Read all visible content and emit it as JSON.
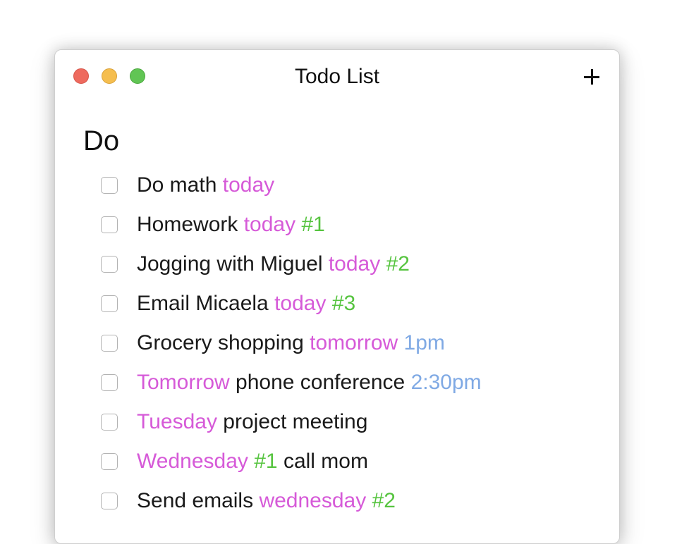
{
  "window": {
    "title": "Todo List",
    "add_label": "+"
  },
  "section": {
    "heading": "Do"
  },
  "colors": {
    "date": "#d65ad8",
    "tag": "#56c43f",
    "time": "#7fa9e4",
    "text": "#1a1a1a"
  },
  "todos": [
    {
      "checked": false,
      "segments": [
        {
          "text": "Do math",
          "kind": "plain"
        },
        {
          "text": "today",
          "kind": "date"
        }
      ]
    },
    {
      "checked": false,
      "segments": [
        {
          "text": "Homework",
          "kind": "plain"
        },
        {
          "text": "today",
          "kind": "date"
        },
        {
          "text": "#1",
          "kind": "tag"
        }
      ]
    },
    {
      "checked": false,
      "segments": [
        {
          "text": "Jogging with Miguel",
          "kind": "plain"
        },
        {
          "text": "today",
          "kind": "date"
        },
        {
          "text": "#2",
          "kind": "tag"
        }
      ]
    },
    {
      "checked": false,
      "segments": [
        {
          "text": "Email Micaela",
          "kind": "plain"
        },
        {
          "text": "today",
          "kind": "date"
        },
        {
          "text": "#3",
          "kind": "tag"
        }
      ]
    },
    {
      "checked": false,
      "segments": [
        {
          "text": "Grocery shopping",
          "kind": "plain"
        },
        {
          "text": "tomorrow",
          "kind": "date"
        },
        {
          "text": "1pm",
          "kind": "time"
        }
      ]
    },
    {
      "checked": false,
      "segments": [
        {
          "text": "Tomorrow",
          "kind": "date"
        },
        {
          "text": "phone conference",
          "kind": "plain"
        },
        {
          "text": "2:30pm",
          "kind": "time"
        }
      ]
    },
    {
      "checked": false,
      "segments": [
        {
          "text": "Tuesday",
          "kind": "date"
        },
        {
          "text": "project meeting",
          "kind": "plain"
        }
      ]
    },
    {
      "checked": false,
      "segments": [
        {
          "text": "Wednesday",
          "kind": "date"
        },
        {
          "text": "#1",
          "kind": "tag"
        },
        {
          "text": "call mom",
          "kind": "plain"
        }
      ]
    },
    {
      "checked": false,
      "segments": [
        {
          "text": "Send emails",
          "kind": "plain"
        },
        {
          "text": "wednesday",
          "kind": "date"
        },
        {
          "text": "#2",
          "kind": "tag"
        }
      ]
    }
  ]
}
